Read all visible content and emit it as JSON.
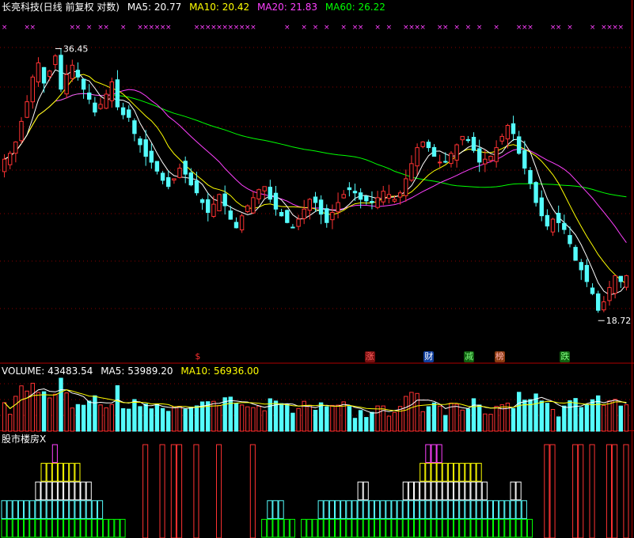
{
  "header": {
    "title": "长亮科技(日线 前复权 对数)",
    "ma": [
      {
        "label": "MA5: 20.77",
        "color": "#ffffff"
      },
      {
        "label": "MA10: 20.42",
        "color": "#ffff00"
      },
      {
        "label": "MA20: 21.83",
        "color": "#ff40ff"
      },
      {
        "label": "MA60: 26.22",
        "color": "#00ff00"
      }
    ]
  },
  "volume_header": {
    "title": "VOLUME: 43483.54",
    "ma5": "MA5: 53989.20",
    "ma10": "MA10: 56936.00"
  },
  "indicator_header": {
    "title": "股市楼房X"
  },
  "annotations": {
    "high": "36.45",
    "low": "18.72"
  },
  "badges": [
    {
      "label": "$",
      "color": "#ff3030",
      "bg": "transparent",
      "x_pos": 0.312
    },
    {
      "label": "涨",
      "color": "#ff6060",
      "bg": "#7a1010",
      "x_pos": 0.586
    },
    {
      "label": "财",
      "color": "#ffffff",
      "bg": "#1040a0",
      "x_pos": 0.68
    },
    {
      "label": "减",
      "color": "#80ff80",
      "bg": "#106010",
      "x_pos": 0.744
    },
    {
      "label": "榜",
      "color": "#ffb0b0",
      "bg": "#8a3a10",
      "x_pos": 0.793
    },
    {
      "label": "跌",
      "color": "#80ff80",
      "bg": "#106010",
      "x_pos": 0.897
    }
  ],
  "colors": {
    "up": "#ff3232",
    "down": "#54fcfc",
    "ma5": "#ffffff",
    "ma10": "#ffff00",
    "ma20": "#ff40ff",
    "ma60": "#00ff00",
    "grid": "#8a0000",
    "marker": "#ff40ff"
  },
  "chart_data": {
    "type": "candlestick",
    "title": "长亮科技(日线 前复权 对数)",
    "y_scale": "log",
    "ylim": [
      17.5,
      39.5
    ],
    "price_high": 36.45,
    "price_low": 18.72,
    "closes": [
      27.8,
      28.2,
      29.0,
      30.5,
      32.0,
      34.0,
      35.2,
      33.5,
      34.5,
      35.8,
      33.0,
      34.2,
      35.0,
      34.0,
      33.0,
      32.2,
      31.2,
      31.8,
      32.6,
      33.6,
      31.6,
      31.0,
      30.8,
      29.6,
      28.8,
      28.0,
      27.6,
      27.0,
      26.4,
      26.0,
      26.5,
      27.2,
      26.8,
      26.1,
      25.6,
      25.0,
      24.4,
      24.9,
      25.5,
      24.8,
      24.0,
      23.5,
      24.2,
      24.8,
      25.3,
      25.8,
      26.0,
      25.2,
      24.6,
      24.2,
      23.8,
      23.5,
      24.0,
      24.6,
      25.2,
      25.0,
      24.3,
      23.8,
      24.4,
      25.0,
      25.5,
      25.8,
      25.6,
      25.2,
      25.1,
      25.0,
      25.3,
      25.7,
      25.5,
      25.2,
      25.6,
      26.5,
      27.5,
      28.6,
      29.0,
      28.6,
      28.0,
      27.6,
      27.6,
      28.2,
      28.8,
      29.4,
      29.1,
      28.4,
      27.6,
      27.8,
      28.0,
      28.6,
      29.4,
      30.2,
      29.6,
      28.2,
      27.2,
      26.2,
      25.0,
      24.2,
      23.6,
      24.0,
      23.8,
      23.4,
      22.6,
      21.7,
      21.2,
      20.6,
      20.0,
      19.2,
      19.6,
      20.3,
      20.9,
      20.6,
      20.9
    ],
    "vol_ylim": [
      0,
      160000
    ],
    "series": [
      {
        "name": "MA5",
        "values": [
          27.8,
          28.2,
          29.0,
          30.5,
          32.0,
          34.0,
          35.2,
          33.5,
          34.5,
          35.8,
          33.0,
          34.2,
          35.0,
          34.0,
          33.0,
          32.2,
          31.2,
          31.8,
          32.6,
          33.6,
          31.6,
          31.0,
          30.8,
          29.6,
          28.8,
          28.0,
          27.6,
          27.0,
          26.4,
          26.0,
          26.5,
          27.2,
          26.8,
          26.1,
          25.6,
          25.0,
          24.4,
          24.9,
          25.5,
          24.8,
          24.0,
          23.5,
          24.2,
          24.8,
          25.3,
          25.8,
          26.0,
          25.2,
          24.6,
          24.2,
          23.8,
          23.5,
          24.0,
          24.6,
          25.2,
          25.0,
          24.3,
          23.8,
          24.4,
          25.0,
          25.5,
          25.8,
          25.6,
          25.2,
          25.1,
          25.0,
          25.3,
          25.7,
          25.5,
          25.2,
          25.6,
          26.5,
          27.5,
          28.6,
          29.0,
          28.6,
          28.0,
          27.6,
          27.6,
          28.2,
          28.8,
          29.4,
          29.1,
          28.4,
          27.6,
          27.8,
          28.0,
          28.6,
          29.4,
          30.2,
          29.6,
          28.2,
          27.2,
          26.2,
          25.0,
          24.2,
          23.6,
          24.0,
          23.8,
          23.4,
          22.6,
          21.7,
          21.2,
          20.6,
          20.0,
          19.2,
          19.6,
          20.3,
          20.9,
          20.6,
          20.9
        ]
      },
      {
        "name": "MA10",
        "values": []
      },
      {
        "name": "MA20",
        "values": []
      },
      {
        "name": "MA60",
        "values": []
      }
    ]
  }
}
